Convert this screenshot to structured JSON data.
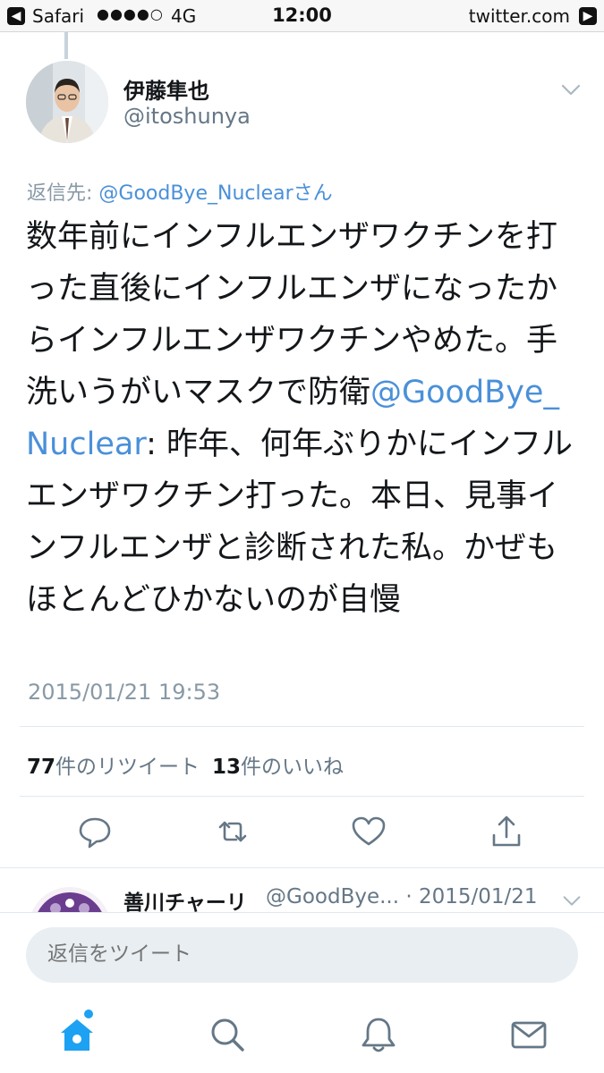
{
  "status_bar": {
    "back_app": "Safari",
    "signal": "●●●●○",
    "network": "4G",
    "time": "12:00",
    "site": "twitter.com"
  },
  "tweet": {
    "author": {
      "display_name": "伊藤隼也",
      "handle": "@itoshunya"
    },
    "reply_to_prefix": "返信先: ",
    "reply_to_handle": "@GoodBye_Nuclearさん",
    "text_part1": "数年前にインフルエンザワクチンを打った直後にインフルエンザになったからインフルエンザワクチンやめた。手洗いうがいマスクで防衛",
    "text_mention": "@GoodBye_Nuclear",
    "text_part2": ": 昨年、何年ぶりかにインフルエンザワクチン打った。本日、見事インフルエンザと診断された私。かぜもほとんどひかないのが自慢",
    "timestamp": "2015/01/21 19:53",
    "retweet_count": "77",
    "retweet_label": "件のリツイート",
    "like_count": "13",
    "like_label": "件のいいね"
  },
  "actions": [
    {
      "name": "reply",
      "icon": "reply-icon"
    },
    {
      "name": "retweet",
      "icon": "retweet-icon"
    },
    {
      "name": "like",
      "icon": "heart-icon"
    },
    {
      "name": "share",
      "icon": "share-icon"
    }
  ],
  "next_reply": {
    "display_name": "善川チャーリ",
    "meta": "@GoodBye... · 2015/01/21"
  },
  "reply_box": {
    "placeholder": "返信をツイート"
  },
  "tabs": [
    {
      "name": "home",
      "icon": "home-icon"
    },
    {
      "name": "search",
      "icon": "search-icon"
    },
    {
      "name": "notifications",
      "icon": "bell-icon"
    },
    {
      "name": "messages",
      "icon": "mail-icon"
    }
  ],
  "colors": {
    "accent": "#1da1f2",
    "link": "#4a90d9",
    "icon": "#657786"
  }
}
